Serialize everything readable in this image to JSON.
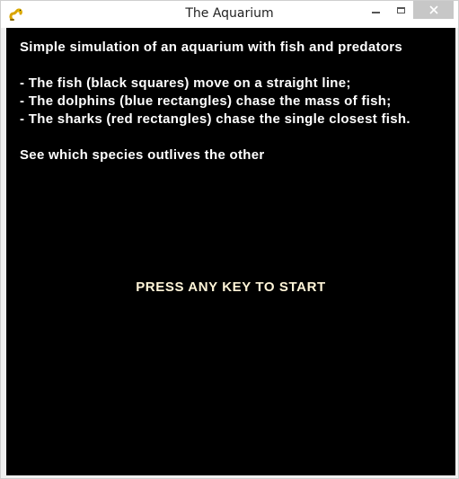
{
  "window": {
    "title": "The Aquarium",
    "icon": "pygame-snake-icon",
    "controls": [
      "minimize",
      "maximize",
      "close"
    ]
  },
  "game": {
    "intro_title": "Simple simulation of an aquarium with fish and predators",
    "rules": [
      "- The fish (black squares) move on a straight line;",
      "- The dolphins (blue rectangles) chase the mass of fish;",
      "- The sharks (red rectangles) chase the single closest fish."
    ],
    "closing": "See which species outlives the other",
    "start_prompt": "PRESS ANY KEY TO START"
  },
  "colors": {
    "background": "#000000",
    "text": "#ffffff",
    "prompt": "#fff5d8",
    "close_button": "#c7c7c7"
  }
}
